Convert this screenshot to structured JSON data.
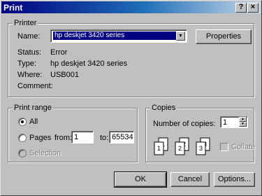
{
  "window": {
    "title": "Print",
    "help_label": "?",
    "close_label": "×"
  },
  "printer": {
    "legend": "Printer",
    "name_label": "Name:",
    "name_value": "hp deskjet 3420 series",
    "properties_label": "Properties",
    "status_label": "Status:",
    "status_value": "Error",
    "type_label": "Type:",
    "type_value": "hp deskjet 3420 series",
    "where_label": "Where:",
    "where_value": "USB001",
    "comment_label": "Comment:",
    "comment_value": ""
  },
  "print_range": {
    "legend": "Print range",
    "all_label": "All",
    "pages_label": "Pages",
    "from_label": "from:",
    "from_value": "1",
    "to_label": "to:",
    "to_value": "65534",
    "selection_label": "Selection",
    "selected": "all"
  },
  "copies": {
    "legend": "Copies",
    "number_label": "Number of copies:",
    "number_value": "1",
    "collate_label": "Collate",
    "collate_checked": false,
    "page_glyphs": [
      "1",
      "1",
      "2",
      "2",
      "3",
      "3"
    ]
  },
  "buttons": {
    "ok": "OK",
    "cancel": "Cancel",
    "options": "Options..."
  }
}
